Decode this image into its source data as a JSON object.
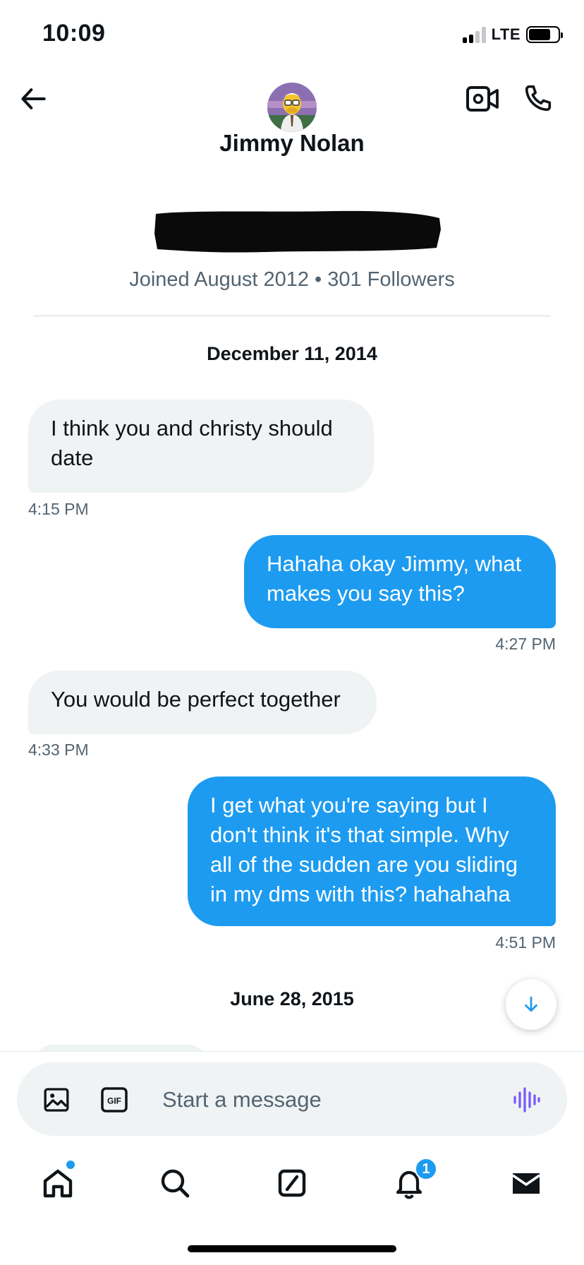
{
  "status_bar": {
    "time": "10:09",
    "network": "LTE"
  },
  "header": {
    "contact_name": "Jimmy Nolan",
    "icons": [
      "back-arrow-icon",
      "video-camera-icon",
      "phone-icon"
    ]
  },
  "profile": {
    "meta": "Joined August 2012 • 301 Followers",
    "bio_redacted": true
  },
  "conversation": {
    "date_1": "December 11, 2014",
    "messages": [
      {
        "direction": "incoming",
        "text": "I think you and christy should date",
        "time": "4:15 PM"
      },
      {
        "direction": "outgoing",
        "text": "Hahaha okay Jimmy, what makes you say this?",
        "time": "4:27 PM"
      },
      {
        "direction": "incoming",
        "text": "You would be perfect together",
        "time": "4:33 PM"
      },
      {
        "direction": "outgoing",
        "text": "I get what you're saying but I don't think it's that simple. Why all of the sudden are you sliding in my dms with this? hahahaha",
        "time": "4:51 PM"
      }
    ],
    "date_2": "June 28, 2015"
  },
  "composer": {
    "placeholder": "Start a message",
    "gif_label": "GIF"
  },
  "tab_bar": {
    "items": [
      "home",
      "search",
      "compose",
      "notifications",
      "messages"
    ],
    "notifications_badge": "1"
  },
  "colors": {
    "accent": "#1d9bf0",
    "incoming_bubble": "#eff3f4",
    "secondary_text": "#536471",
    "voice_icon": "#7856ff"
  }
}
